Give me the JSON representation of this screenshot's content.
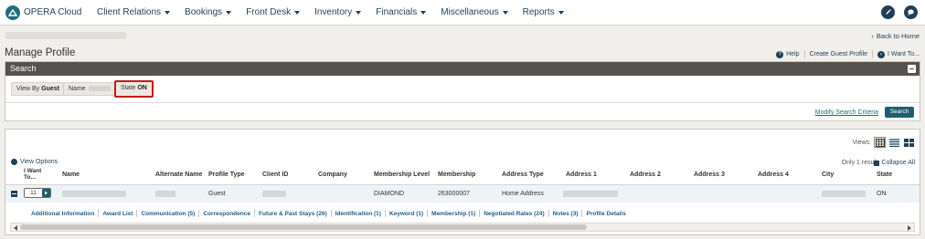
{
  "app": {
    "title": "OPERA Cloud"
  },
  "nav": [
    {
      "label": "Client Relations"
    },
    {
      "label": "Bookings"
    },
    {
      "label": "Front Desk"
    },
    {
      "label": "Inventory"
    },
    {
      "label": "Financials"
    },
    {
      "label": "Miscellaneous"
    },
    {
      "label": "Reports"
    }
  ],
  "topbar_icons": [
    "rocket-icon",
    "chat-icon"
  ],
  "page": {
    "back_home": "Back to Home",
    "title": "Manage Profile",
    "help": "Help",
    "create_guest": "Create Guest Profile",
    "i_want_to": "I Want To..."
  },
  "search": {
    "header": "Search",
    "chips": [
      {
        "label": "View By",
        "value": "Guest"
      },
      {
        "label": "Name",
        "value": ""
      },
      {
        "label": "State",
        "value": "ON"
      }
    ],
    "modify": "Modify Search Criteria",
    "button": "Search"
  },
  "results": {
    "view_options": "View Options",
    "views_label": "Views:",
    "count": "Only 1 result",
    "collapse_all": "Collapse All",
    "columns": [
      "I Want To...",
      "Name",
      "Alternate Name",
      "Profile Type",
      "Client ID",
      "Company",
      "Membership Level",
      "Membership",
      "Address Type",
      "Address 1",
      "Address 2",
      "Address 3",
      "Address 4",
      "City",
      "State"
    ],
    "row": {
      "i_want_value": "11",
      "profile_type": "Guest",
      "membership_level": "DIAMOND",
      "membership": "263000007",
      "address_type": "Home Address",
      "state": "ON"
    },
    "links": [
      "Additional Information",
      "Award List",
      "Communication (5)",
      "Correspondence",
      "Future & Past Stays (26)",
      "Identification (1)",
      "Keyword (1)",
      "Membership (1)",
      "Negotiated Rates (24)",
      "Notes (3)",
      "Profile Details"
    ]
  },
  "colors": {
    "header_dark": "#56534f",
    "accent": "#1f5f6d",
    "highlight": "#c41a1a"
  }
}
